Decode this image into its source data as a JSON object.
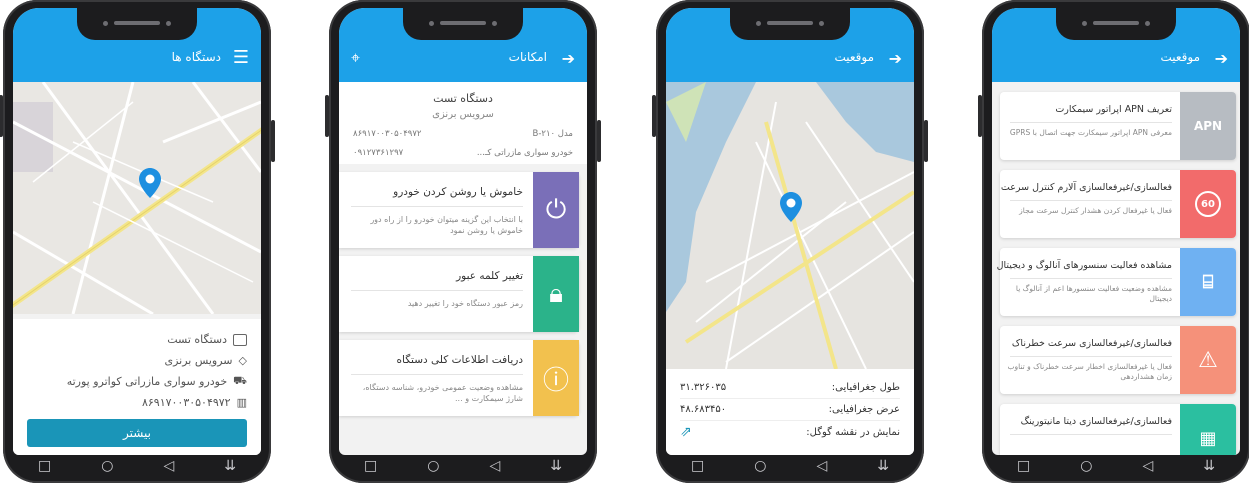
{
  "phone1": {
    "title": "دستگاه ها",
    "device_name": "دستگاه تست",
    "service": "سرویس برنزی",
    "vehicle": "خودرو سواری مازراتی کواترو پورته",
    "imei": "۸۶۹۱۷۰۰۳۰۵۰۴۹۷۲",
    "more_button": "بیشتر",
    "icons": [
      "hamburger-icon",
      "device-icon",
      "diamond-icon",
      "car-icon",
      "barcode-icon"
    ]
  },
  "phone2": {
    "title": "امکانات",
    "device_name": "دستگاه تست",
    "service": "سرویس برنزی",
    "model": "مدل B-۲۱۰",
    "imei": "۸۶۹۱۷۰۰۳۰۵۰۴۹۷۲",
    "vehicle": "خودرو سواری مازراتی کـ...",
    "sim": "۰۹۱۲۷۳۶۱۲۹۷",
    "features": [
      {
        "title": "خاموش یا روشن کردن خودرو",
        "desc": "با انتخاب این گزینه میتوان خودرو را از راه دور خاموش یا روشن نمود",
        "color": "#7a6fb8",
        "icon": "power-icon"
      },
      {
        "title": "تغییر کلمه عبور",
        "desc": "رمز عبور دستگاه خود را تغییر دهید",
        "color": "#2bb38a",
        "icon": "lock-icon"
      },
      {
        "title": "دریافت اطلاعات کلی دستگاه",
        "desc": "مشاهده وضعیت عمومی خودرو، شناسه دستگاه، شارژ سیمکارت و ...",
        "color": "#f2c14e",
        "icon": "info-icon"
      }
    ]
  },
  "phone3": {
    "title": "موقعیت",
    "longitude_label": "طول جغرافیایی:",
    "longitude_value": "۳۱.۳۲۶۰۳۵",
    "latitude_label": "عرض جغرافیایی:",
    "latitude_value": "۴۸.۶۸۳۴۵۰",
    "google_label": "نمایش در نقشه گوگل:"
  },
  "phone4": {
    "title": "موقعیت",
    "features": [
      {
        "title": "تعریف APN اپراتور سیمکارت",
        "desc": "معرفی APN اپراتور سیمکارت جهت اتصال با GPRS",
        "color": "#b7bcc2",
        "tile": "APN",
        "icon": "apn-icon"
      },
      {
        "title": "فعالسازی/غیرفعالسازی آلارم کنترل سرعت",
        "desc": "فعال یا غیرفعال کردن هشدار کنترل سرعت مجاز",
        "color": "#f26b6b",
        "tile": "60",
        "icon": "speed-limit-icon"
      },
      {
        "title": "مشاهده فعالیت سنسورهای آنالوگ و دیجیتال",
        "desc": "مشاهده وضعیت فعالیت سنسورها اعم از آنالوگ یا دیجیتال",
        "color": "#6fb1f2",
        "tile": "",
        "icon": "sensor-icon"
      },
      {
        "title": "فعالسازی/غیرفعالسازی سرعت خطرناک",
        "desc": "فعال یا غیرفعالسازی اخطار سرعت خطرناک و تناوب زمان هشداردهی",
        "color": "#f5917a",
        "tile": "",
        "icon": "warning-icon"
      },
      {
        "title": "فعالسازی/غیرفعالسازی دیتا مانیتورینگ",
        "desc": "",
        "color": "#2bbfa0",
        "tile": "",
        "icon": "monitor-icon"
      }
    ]
  }
}
